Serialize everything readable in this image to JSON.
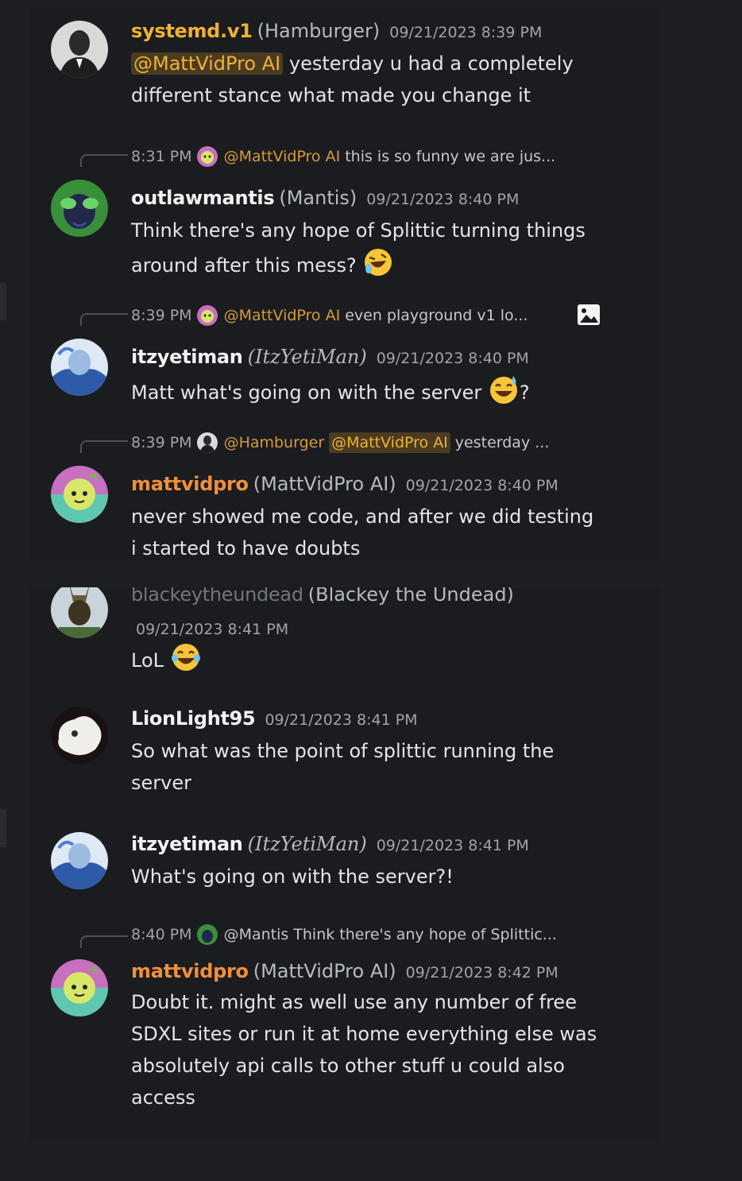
{
  "panel1": {
    "messages": [
      {
        "username": "systemd.v1",
        "nickname": "(Hamburger)",
        "timestamp": "09/21/2023 8:39 PM",
        "mention": "@MattVidPro AI",
        "text_line1": " yesterday u had a completely",
        "text_line2": "different stance what made you change it"
      },
      {
        "reply": {
          "time": "8:31 PM",
          "mention": "@MattVidPro AI",
          "text": "this is so funny we are jus..."
        },
        "username": "outlawmantis",
        "nickname": "(Mantis)",
        "timestamp": "09/21/2023 8:40 PM",
        "text_line1": "Think there's any hope of Splittic turning things",
        "text_line2": "around after this mess?"
      },
      {
        "reply": {
          "time": "8:39 PM",
          "mention": "@MattVidPro AI",
          "text": "even playground v1 lo..."
        },
        "username": "itzyetiman",
        "nickname": "(ItzYetiMan)",
        "timestamp": "09/21/2023 8:40 PM",
        "text_line1": "Matt what's going on with the server",
        "text_end": "?"
      },
      {
        "reply": {
          "time": "8:39 PM",
          "mention1": "@Hamburger",
          "mention2": "@MattVidPro AI",
          "text": "yesterday ..."
        },
        "username": "mattvidpro",
        "nickname": "(MattVidPro AI)",
        "timestamp": "09/21/2023 8:40 PM",
        "text_line1": "never showed me code, and after we did testing",
        "text_line2": "i started to have doubts"
      }
    ]
  },
  "panel2": {
    "messages": [
      {
        "username": "blackeytheundead",
        "nickname": "(Blackey the Undead)",
        "timestamp": "09/21/2023 8:41 PM",
        "text_line1": "LoL"
      },
      {
        "username": "LionLight95",
        "timestamp": "09/21/2023 8:41 PM",
        "text_line1": "So what was the point of splittic running the",
        "text_line2": "server"
      },
      {
        "username": "itzyetiman",
        "nickname": "(ItzYetiMan)",
        "timestamp": "09/21/2023 8:41 PM",
        "text_line1": "What's going on with the server?!"
      },
      {
        "reply": {
          "time": "8:40 PM",
          "mention": "@Mantis",
          "text": "Think there's any hope of Splittic..."
        },
        "username": "mattvidpro",
        "nickname": "(MattVidPro AI)",
        "timestamp": "09/21/2023 8:42 PM",
        "text_line1": "Doubt it. might as well use any number of free",
        "text_line2": "SDXL sites or run it at home everything else was",
        "text_line3": "absolutely api calls to other stuff u could also",
        "text_line4": "access"
      }
    ]
  },
  "colors": {
    "background": "#1d1e21",
    "panel": "#1b1c1f",
    "mention_text": "#f0b232",
    "mention_bg": "#4a3b22",
    "owner_name": "#f08f3c"
  }
}
